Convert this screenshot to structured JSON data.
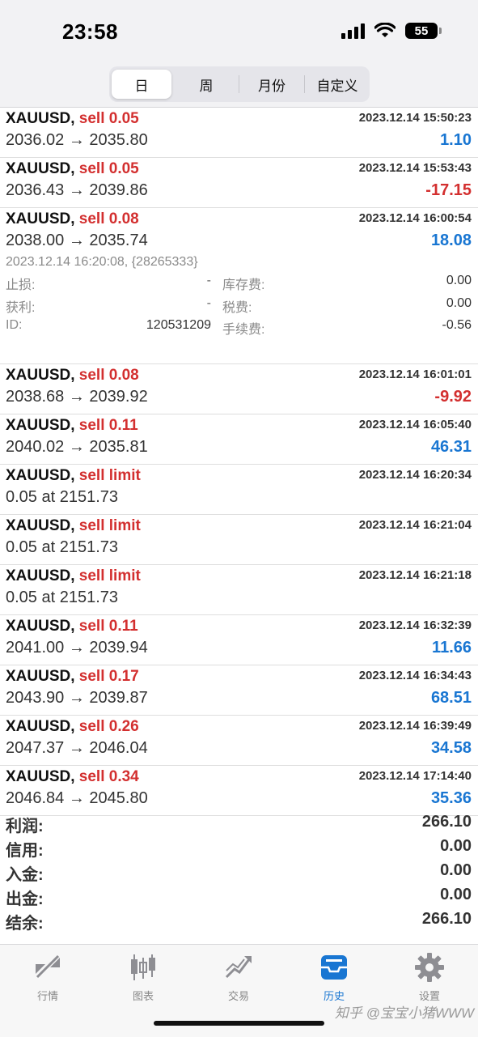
{
  "status": {
    "time": "23:58",
    "battery": "55"
  },
  "tabs": [
    "日",
    "周",
    "月份",
    "自定义"
  ],
  "trades": [
    {
      "symbol": "XAUUSD,",
      "action": "sell 0.05",
      "date": "2023.12.14 15:50:23",
      "price": "2036.02 → 2035.80",
      "profit": "1.10",
      "sign": "pos"
    },
    {
      "symbol": "XAUUSD,",
      "action": "sell 0.05",
      "date": "2023.12.14 15:53:43",
      "price": "2036.43 → 2039.86",
      "profit": "-17.15",
      "sign": "neg"
    },
    {
      "symbol": "XAUUSD,",
      "action": "sell 0.08",
      "date": "2023.12.14 16:00:54",
      "price": "2038.00 → 2035.74",
      "profit": "18.08",
      "sign": "pos"
    },
    {
      "symbol": "XAUUSD,",
      "action": "sell 0.08",
      "date": "2023.12.14 16:01:01",
      "price": "2038.68 → 2039.92",
      "profit": "-9.92",
      "sign": "neg"
    },
    {
      "symbol": "XAUUSD,",
      "action": "sell 0.11",
      "date": "2023.12.14 16:05:40",
      "price": "2040.02 → 2035.81",
      "profit": "46.31",
      "sign": "pos"
    },
    {
      "symbol": "XAUUSD,",
      "action": "sell limit",
      "date": "2023.12.14 16:20:34",
      "price": "0.05 at 2151.73",
      "profit": "",
      "sign": "pos"
    },
    {
      "symbol": "XAUUSD,",
      "action": "sell limit",
      "date": "2023.12.14 16:21:04",
      "price": "0.05 at 2151.73",
      "profit": "",
      "sign": "pos"
    },
    {
      "symbol": "XAUUSD,",
      "action": "sell limit",
      "date": "2023.12.14 16:21:18",
      "price": "0.05 at 2151.73",
      "profit": "",
      "sign": "pos"
    },
    {
      "symbol": "XAUUSD,",
      "action": "sell 0.11",
      "date": "2023.12.14 16:32:39",
      "price": "2041.00 → 2039.94",
      "profit": "11.66",
      "sign": "pos"
    },
    {
      "symbol": "XAUUSD,",
      "action": "sell 0.17",
      "date": "2023.12.14 16:34:43",
      "price": "2043.90 → 2039.87",
      "profit": "68.51",
      "sign": "pos"
    },
    {
      "symbol": "XAUUSD,",
      "action": "sell 0.26",
      "date": "2023.12.14 16:39:49",
      "price": "2047.37 → 2046.04",
      "profit": "34.58",
      "sign": "pos"
    },
    {
      "symbol": "XAUUSD,",
      "action": "sell 0.34",
      "date": "2023.12.14 17:14:40",
      "price": "2046.84 → 2045.80",
      "profit": "35.36",
      "sign": "pos"
    }
  ],
  "detail": {
    "line": "2023.12.14 16:20:08, {28265333}",
    "sl_label": "止损:",
    "sl_value": "-",
    "swap_label": "库存费:",
    "swap_value": "0.00",
    "tp_label": "获利:",
    "tp_value": "-",
    "tax_label": "税费:",
    "tax_value": "0.00",
    "id_label": "ID:",
    "id_value": "120531209",
    "fee_label": "手续费:",
    "fee_value": "-0.56"
  },
  "summary": [
    {
      "label": "利润:",
      "value": "266.10"
    },
    {
      "label": "信用:",
      "value": "0.00"
    },
    {
      "label": "入金:",
      "value": "0.00"
    },
    {
      "label": "出金:",
      "value": "0.00"
    },
    {
      "label": "结余:",
      "value": "266.10"
    }
  ],
  "tabbar": [
    {
      "label": "行情",
      "icon": "quotes-icon"
    },
    {
      "label": "图表",
      "icon": "chart-icon"
    },
    {
      "label": "交易",
      "icon": "trade-icon"
    },
    {
      "label": "历史",
      "icon": "history-icon"
    },
    {
      "label": "设置",
      "icon": "settings-icon"
    }
  ],
  "watermark": "知乎 @宝宝小猪WWW",
  "colors": {
    "sell": "#d32f2f",
    "positive": "#1976d2",
    "negative": "#d32f2f",
    "active_tab": "#1976d2"
  }
}
